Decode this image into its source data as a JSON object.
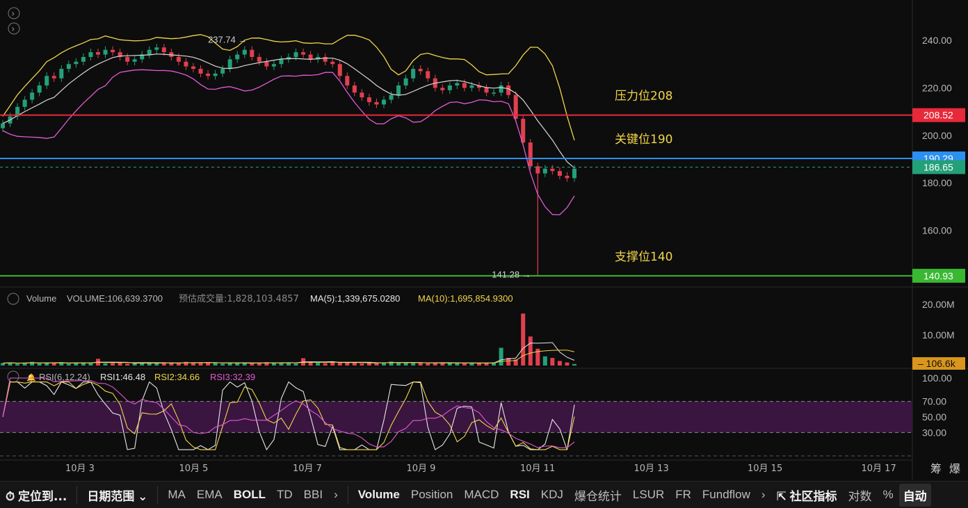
{
  "chart_data": {
    "type": "candlestick",
    "price_axis": {
      "ticks": [
        "240.00",
        "220.00",
        "200.00",
        "180.00",
        "160.00"
      ],
      "ylim": [
        135,
        250
      ]
    },
    "x_axis": {
      "ticks": [
        "10月 3",
        "10月 5",
        "10月 7",
        "10月 9",
        "10月 11",
        "10月 13",
        "10月 15",
        "10月 17"
      ]
    },
    "high_marker": "237.74",
    "low_marker": "141.28",
    "price_lines": [
      {
        "label": "压力位208",
        "value": 208.52,
        "tag": "208.52",
        "color": "#e8293a"
      },
      {
        "label": "关键位190",
        "value": 190.29,
        "tag": "190.29",
        "color": "#2d8ff0"
      },
      {
        "label": "支撑位140",
        "value": 140.93,
        "tag": "140.93",
        "color": "#3ab832"
      }
    ],
    "last_price": {
      "value": 186.65,
      "tag": "186.65",
      "color": "#24a079"
    },
    "candles_close": [
      205,
      208,
      212,
      215,
      218,
      221,
      225,
      224,
      228,
      230,
      231,
      233,
      235,
      234,
      236,
      235,
      233,
      231,
      232,
      234,
      236,
      237,
      235,
      233,
      231,
      229,
      228,
      226,
      225,
      226,
      228,
      232,
      234,
      236,
      233,
      231,
      229,
      230,
      232,
      233,
      235,
      234,
      232,
      233,
      231,
      230,
      225,
      221,
      218,
      216,
      214,
      213,
      215,
      217,
      221,
      224,
      228,
      227,
      224,
      220,
      219,
      221,
      222,
      220,
      221,
      220,
      218,
      218,
      221,
      217,
      207,
      197,
      187,
      184,
      186,
      185,
      183,
      182,
      186
    ],
    "bollinger": {
      "upper_label": "upper",
      "shown": true
    },
    "volume_panel": {
      "legend_name": "Volume",
      "volume_label": "VOLUME:106,639.3700",
      "est_label": "预估成交量:1,828,103.4857",
      "ma5_label": "MA(5):1,339,675.0280",
      "ma10_label": "MA(10):1,695,854.9300",
      "ticks": [
        "20.00M",
        "10.00M"
      ],
      "last_tag": "106.6k",
      "values_m": [
        0.8,
        1.0,
        0.6,
        0.9,
        1.2,
        0.7,
        0.9,
        0.8,
        1.1,
        0.6,
        0.9,
        1.0,
        0.8,
        2.2,
        0.7,
        0.8,
        0.9,
        0.6,
        0.8,
        1.0,
        0.9,
        0.7,
        0.8,
        1.0,
        0.9,
        1.2,
        0.8,
        0.9,
        1.1,
        0.8,
        0.6,
        0.9,
        1.0,
        0.8,
        0.7,
        0.9,
        1.1,
        0.8,
        1.0,
        0.9,
        0.7,
        2.4,
        1.1,
        0.9,
        0.8,
        1.2,
        1.0,
        0.9,
        1.0,
        0.7,
        0.9,
        0.8,
        1.0,
        1.3,
        0.9,
        1.0,
        0.8,
        0.9,
        0.7,
        0.9,
        1.0,
        0.8,
        0.9,
        0.7,
        0.8,
        0.9,
        0.8,
        1.0,
        5.8,
        2.5,
        2.0,
        17.0,
        9.5,
        5.5,
        3.0,
        2.5,
        1.5,
        1.0,
        0.5
      ]
    },
    "rsi_panel": {
      "name": "RSI(6,12,24)",
      "rsi1_label": "RSI1:46.48",
      "rsi2_label": "RSI2:34.66",
      "rsi3_label": "RSI3:32.39",
      "ticks": [
        "100.00",
        "70.00",
        "50.00",
        "30.00"
      ]
    }
  },
  "toolbar": {
    "locate": "定位到...",
    "date_range": "日期范围",
    "indicators_main": [
      "MA",
      "EMA",
      "BOLL",
      "TD",
      "BBI"
    ],
    "indicators_sub": [
      "Volume",
      "Position",
      "MACD",
      "RSI",
      "KDJ",
      "爆仓统计",
      "LSUR",
      "FR",
      "Fundflow"
    ],
    "community": "社区指标",
    "log": "对数",
    "percent": "%",
    "auto": "自动",
    "side_labels": [
      "筹",
      "爆"
    ]
  },
  "colors": {
    "up": "#24a079",
    "down": "#e0404f",
    "boll_upper": "#f2d54b",
    "boll_mid": "#d8d8d8",
    "boll_lower": "#e15ad6"
  }
}
